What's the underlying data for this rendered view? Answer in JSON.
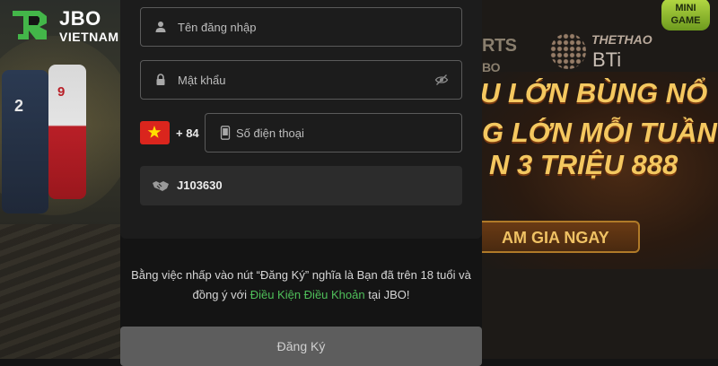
{
  "brand": {
    "name_line1": "JBO",
    "name_line2": "VIETNAM",
    "logo_color": "#43b649"
  },
  "form": {
    "username": {
      "placeholder": "Tên đăng nhập",
      "icon": "user-icon"
    },
    "password": {
      "placeholder": "Mật khẩu",
      "icon": "lock-icon",
      "toggle_icon": "eye-slash-icon"
    },
    "phone": {
      "country_flag": "vietnam-flag",
      "country_code": "+ 84",
      "placeholder": "Số điện thoại",
      "icon": "phone-icon"
    },
    "referral": {
      "value": "J103630",
      "icon": "handshake-icon"
    }
  },
  "terms": {
    "line1": "Bằng việc nhấp vào nút “Đăng Ký” nghĩa là Bạn đã trên 18 tuổi và",
    "line2_prefix": "đồng ý với",
    "link": "Điều Kiện Điều Khoản",
    "line2_suffix": "tại JBO!",
    "link_color": "#4fbf5a"
  },
  "submit_label": "Đăng Ký",
  "background": {
    "left_player_numbers": [
      "2",
      "9"
    ],
    "right": {
      "sports_brand": "RTS",
      "sports_brand_sub": "BO",
      "thethao": "THETHAO",
      "bti": "BTi",
      "minigame": "MINI GAME",
      "promo_line1": "U LỚN BÙNG NỔ",
      "promo_line2": "G LỚN MỖI TUẦN",
      "promo_line3": "N 3 TRIỆU 888",
      "promo_cta": "AM GIA NGAY"
    }
  }
}
